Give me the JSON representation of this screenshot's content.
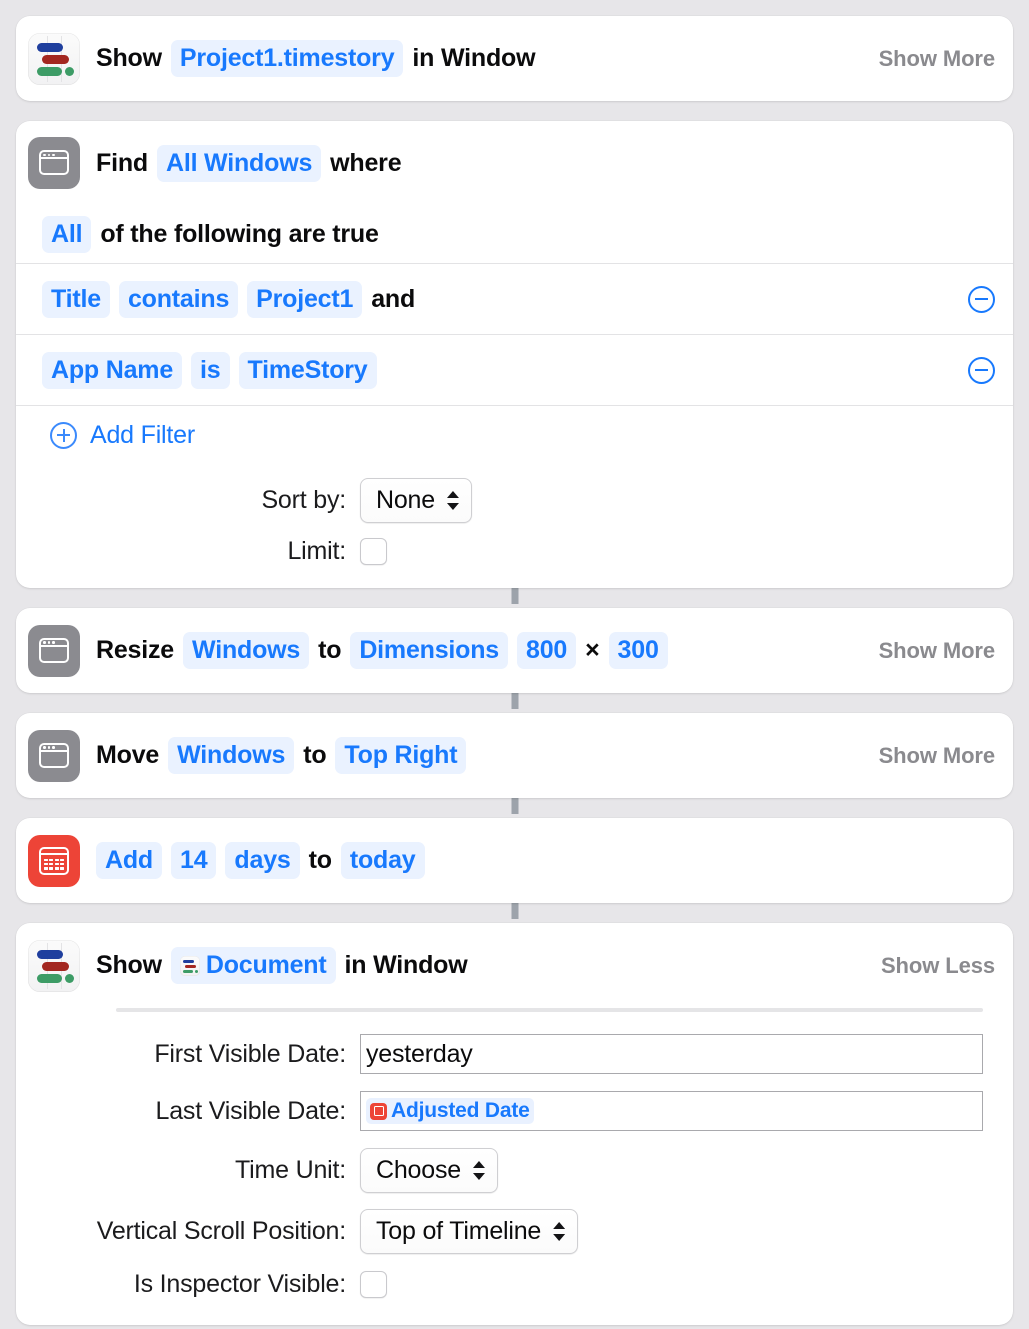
{
  "theme": {
    "accent": "#1879fd",
    "token_bg": "#eaf2ff",
    "canvas_bg": "#e7e6e9",
    "card_bg": "#ffffff",
    "muted_text": "#8a8a8e",
    "calendar_icon_color": "#ed4437",
    "window_icon_color": "#8b8b90"
  },
  "actions": [
    {
      "id": "show-document-window-1",
      "icon": "timestory-app-icon",
      "words": [
        {
          "type": "plain",
          "text": "Show"
        },
        {
          "type": "token",
          "text": "Project1.timestory"
        },
        {
          "type": "plain",
          "text": "in Window"
        }
      ],
      "toggle": "Show More"
    },
    {
      "id": "find-windows",
      "icon": "window-icon",
      "words": [
        {
          "type": "plain",
          "text": "Find"
        },
        {
          "type": "token",
          "text": "All Windows"
        },
        {
          "type": "plain",
          "text": "where"
        }
      ],
      "condition": {
        "quantifier": "All",
        "suffix": "of the following are true"
      },
      "filters": [
        {
          "field": "Title",
          "operator": "contains",
          "value": "Project1",
          "conjunction": "and"
        },
        {
          "field": "App Name",
          "operator": "is",
          "value": "TimeStory",
          "conjunction": ""
        }
      ],
      "add_filter_label": "Add Filter",
      "sort_by": {
        "label": "Sort by:",
        "value": "None"
      },
      "limit": {
        "label": "Limit:",
        "checked": false
      }
    },
    {
      "id": "resize-windows",
      "icon": "window-icon",
      "words": [
        {
          "type": "plain",
          "text": "Resize"
        },
        {
          "type": "token",
          "text": "Windows"
        },
        {
          "type": "plain",
          "text": "to"
        },
        {
          "type": "token",
          "text": "Dimensions"
        },
        {
          "type": "token",
          "text": "800"
        },
        {
          "type": "plain",
          "text": "×"
        },
        {
          "type": "token",
          "text": "300"
        }
      ],
      "toggle": "Show More"
    },
    {
      "id": "move-windows",
      "icon": "window-icon",
      "words": [
        {
          "type": "plain",
          "text": "Move"
        },
        {
          "type": "token",
          "text": "Windows"
        },
        {
          "type": "plain",
          "text": "to"
        },
        {
          "type": "token",
          "text": "Top Right"
        }
      ],
      "toggle": "Show More"
    },
    {
      "id": "adjust-date",
      "icon": "calendar-icon",
      "words": [
        {
          "type": "token",
          "text": "Add"
        },
        {
          "type": "token",
          "text": "14"
        },
        {
          "type": "token",
          "text": "days"
        },
        {
          "type": "plain",
          "text": "to"
        },
        {
          "type": "token",
          "text": "today"
        }
      ],
      "toggle": ""
    },
    {
      "id": "show-document-window-2",
      "icon": "timestory-app-icon",
      "words": [
        {
          "type": "plain",
          "text": "Show"
        },
        {
          "type": "token-with-doc-icon",
          "text": "Document"
        },
        {
          "type": "plain",
          "text": "in Window"
        }
      ],
      "toggle": "Show Less",
      "parameters": [
        {
          "name": "first-visible-date",
          "label": "First Visible Date:",
          "control": "textfield",
          "value": "yesterday"
        },
        {
          "name": "last-visible-date",
          "label": "Last Visible Date:",
          "control": "textfield-variable",
          "value": "Adjusted Date"
        },
        {
          "name": "time-unit",
          "label": "Time Unit:",
          "control": "popup",
          "value": "Choose"
        },
        {
          "name": "vertical-scroll-position",
          "label": "Vertical Scroll Position:",
          "control": "popup",
          "value": "Top of Timeline"
        },
        {
          "name": "is-inspector-visible",
          "label": "Is Inspector Visible:",
          "control": "checkbox",
          "checked": false
        }
      ]
    }
  ]
}
